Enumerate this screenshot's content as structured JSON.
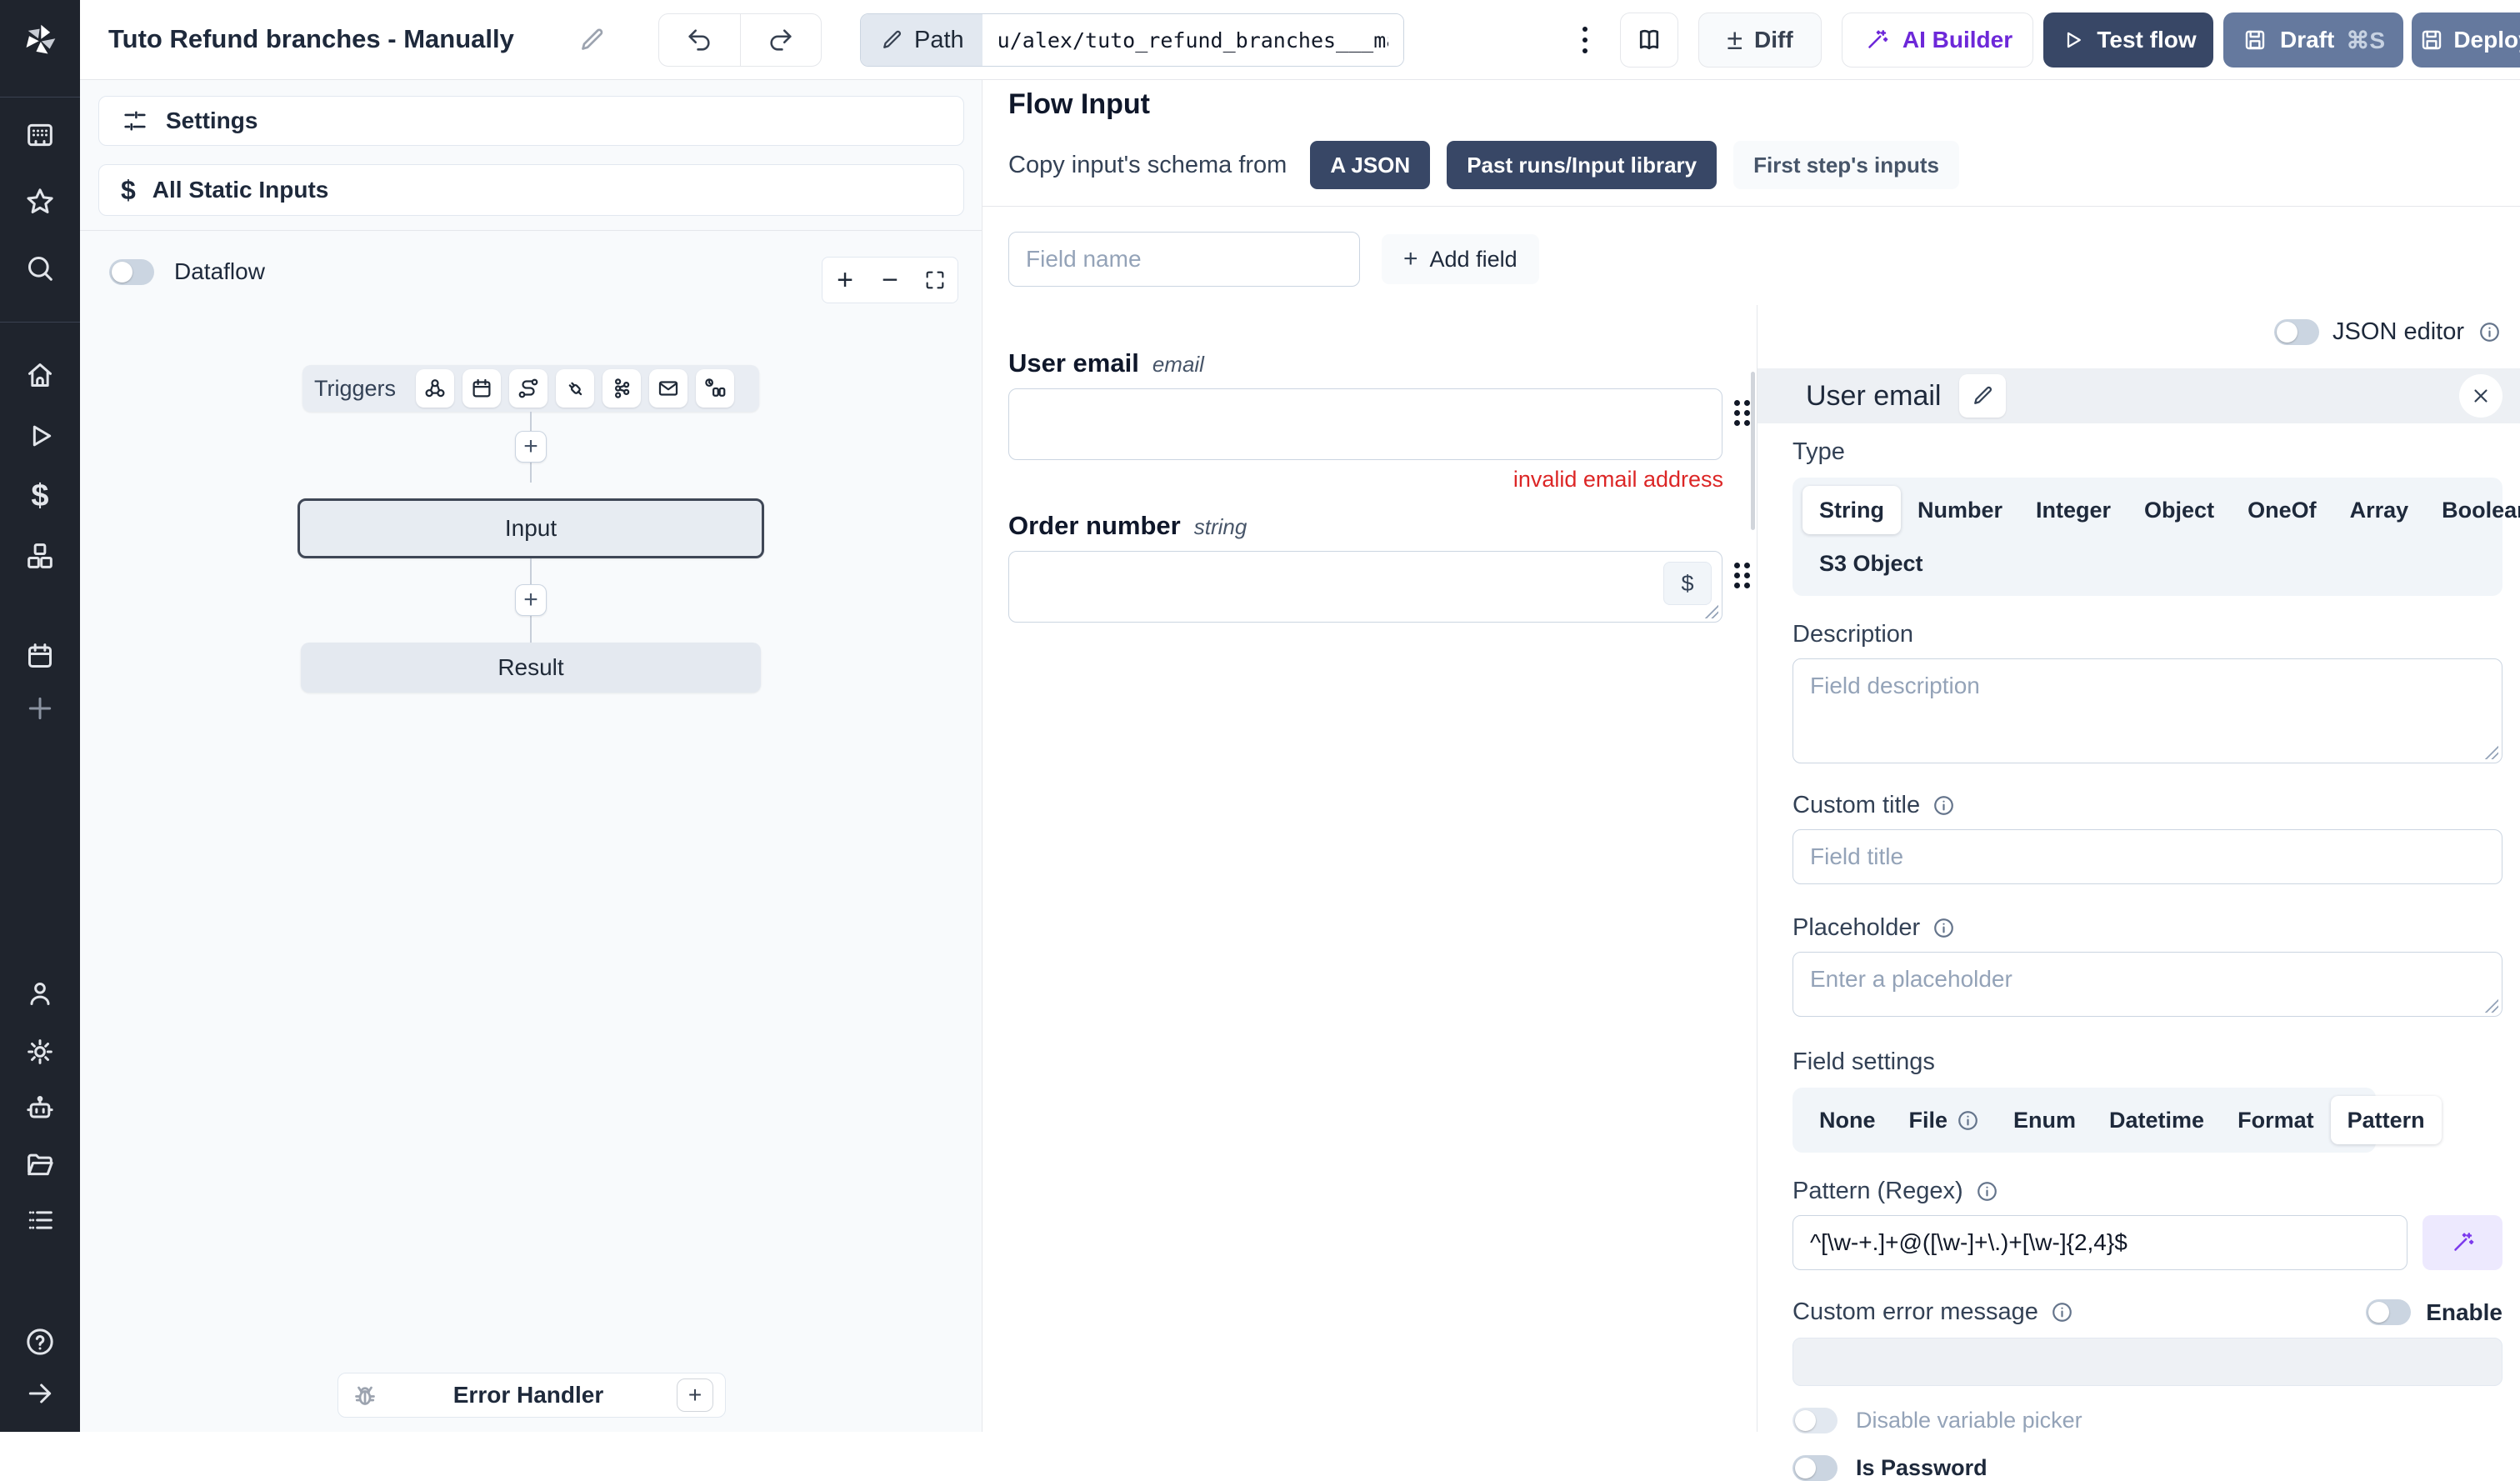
{
  "topbar": {
    "title": "Tuto Refund branches - Manually",
    "path_label": "Path",
    "path_value": "u/alex/tuto_refund_branches___manually",
    "diff_label": "Diff",
    "diff_glyph": "±",
    "ai_builder_label": "AI Builder",
    "test_flow_label": "Test flow",
    "draft_label": "Draft",
    "draft_shortcut": "⌘S",
    "deploy_label": "Deploy"
  },
  "flow_panel": {
    "settings_label": "Settings",
    "all_static_inputs_label": "All Static Inputs",
    "dataflow_label": "Dataflow",
    "triggers_label": "Triggers",
    "input_node_label": "Input",
    "result_node_label": "Result",
    "error_handler_label": "Error Handler",
    "zoom_in_glyph": "+",
    "zoom_out_glyph": "−",
    "add_step_glyph": "+"
  },
  "flow_input": {
    "title": "Flow Input",
    "copy_schema_label": "Copy input's schema from",
    "copy_buttons": [
      "A JSON",
      "Past runs/Input library",
      "First step's inputs"
    ],
    "field_name_placeholder": "Field name",
    "add_field_label": "Add field",
    "add_field_glyph": "+",
    "fields": [
      {
        "name": "User email",
        "type": "email",
        "error": "invalid email address"
      },
      {
        "name": "Order number",
        "type": "string",
        "dollar_glyph": "$"
      }
    ]
  },
  "properties": {
    "json_editor_label": "JSON editor",
    "selected_field_name": "User email",
    "type_label": "Type",
    "types": [
      "String",
      "Number",
      "Integer",
      "Object",
      "OneOf",
      "Array",
      "Boolean",
      "S3 Object"
    ],
    "description_label": "Description",
    "description_placeholder": "Field description",
    "custom_title_label": "Custom title",
    "custom_title_placeholder": "Field title",
    "placeholder_label": "Placeholder",
    "placeholder_placeholder": "Enter a placeholder",
    "field_settings_label": "Field settings",
    "field_settings_options": [
      "None",
      "File",
      "Enum",
      "Datetime",
      "Format",
      "Pattern"
    ],
    "pattern_label": "Pattern (Regex)",
    "pattern_value": "^[\\w-+.]+@([\\w-]+\\.)+[\\w-]{2,4}$",
    "custom_error_label": "Custom error message",
    "enable_label": "Enable",
    "disable_variable_picker_label": "Disable variable picker",
    "is_password_label": "Is Password"
  },
  "colors": {
    "sidebar_bg": "#1f242d",
    "primary_dark": "#384766",
    "secondary_slate": "#65799e",
    "ai_purple": "#6d28d9",
    "error_red": "#dc2626",
    "canvas_bg": "#f8fafc"
  }
}
